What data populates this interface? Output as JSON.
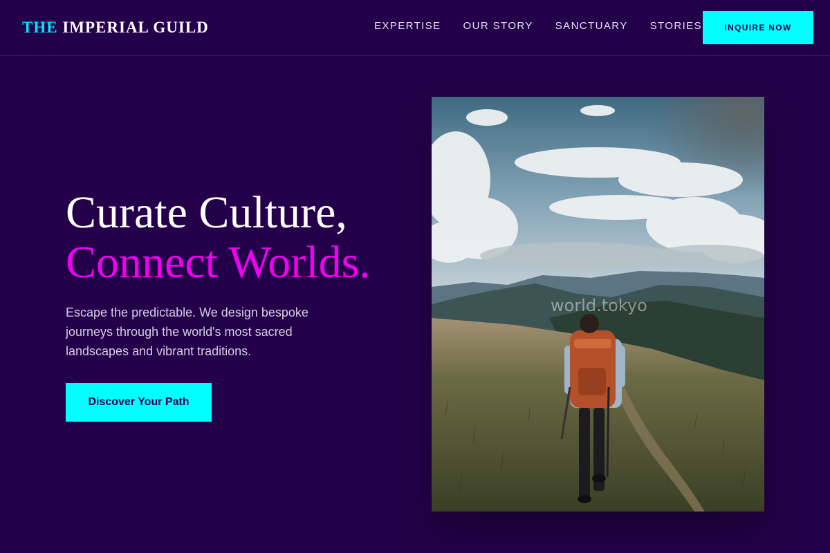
{
  "brand": {
    "accent_word": "THE",
    "name": "IMPERIAL GUILD"
  },
  "nav": {
    "items": [
      {
        "label": "EXPERTISE"
      },
      {
        "label": "OUR STORY"
      },
      {
        "label": "SANCTUARY"
      },
      {
        "label": "STORIES"
      }
    ],
    "cta_label": "INQUIRE NOW"
  },
  "hero": {
    "title_line1": "Curate Culture,",
    "title_line2": "Connect Worlds.",
    "description": "Escape the predictable. We design bespoke journeys through the world's most sacred landscapes and vibrant traditions.",
    "cta_label": "Discover Your Path",
    "image": {
      "subject": "hiker-with-backpack-on-mountain-trail",
      "watermark": "world.tokyo"
    }
  },
  "colors": {
    "background": "#25004a",
    "accent_cyan": "#00ffff",
    "accent_magenta": "#f000f0",
    "text_light": "#ffffff"
  }
}
